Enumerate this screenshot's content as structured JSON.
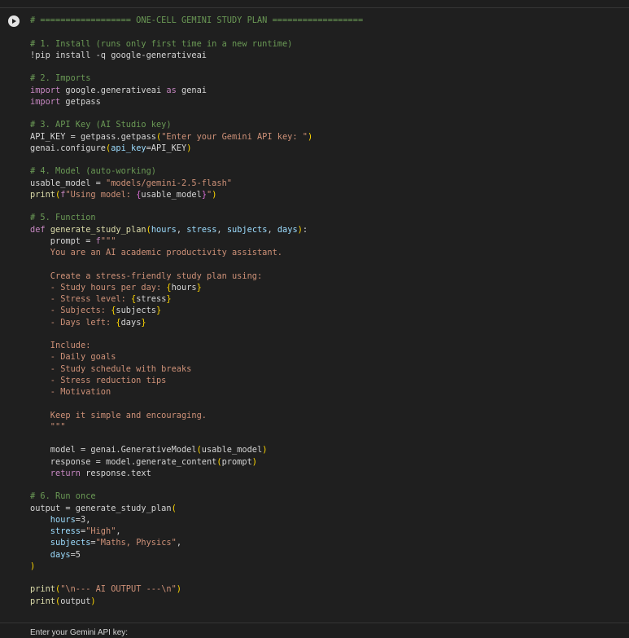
{
  "cell": {
    "run_button_label": "Run cell",
    "lines": [
      [
        {
          "c": "cm",
          "t": "# ================== ONE-CELL GEMINI STUDY PLAN =================="
        }
      ],
      [],
      [
        {
          "c": "cm",
          "t": "# 1. Install (runs only first time in a new runtime)"
        }
      ],
      [
        {
          "c": "txt",
          "t": "!pip install -q google-generativeai"
        }
      ],
      [],
      [
        {
          "c": "cm",
          "t": "# 2. Imports"
        }
      ],
      [
        {
          "c": "kw",
          "t": "import"
        },
        {
          "c": "txt",
          "t": " google.generativeai "
        },
        {
          "c": "kw",
          "t": "as"
        },
        {
          "c": "txt",
          "t": " genai"
        }
      ],
      [
        {
          "c": "kw",
          "t": "import"
        },
        {
          "c": "txt",
          "t": " getpass"
        }
      ],
      [],
      [
        {
          "c": "cm",
          "t": "# 3. API Key (AI Studio key)"
        }
      ],
      [
        {
          "c": "txt",
          "t": "API_KEY = getpass.getpass"
        },
        {
          "c": "br",
          "t": "("
        },
        {
          "c": "str",
          "t": "\"Enter your Gemini API key: \""
        },
        {
          "c": "br",
          "t": ")"
        }
      ],
      [
        {
          "c": "txt",
          "t": "genai.configure"
        },
        {
          "c": "br",
          "t": "("
        },
        {
          "c": "var",
          "t": "api_key"
        },
        {
          "c": "txt",
          "t": "=API_KEY"
        },
        {
          "c": "br",
          "t": ")"
        }
      ],
      [],
      [
        {
          "c": "cm",
          "t": "# 4. Model (auto-working)"
        }
      ],
      [
        {
          "c": "txt",
          "t": "usable_model = "
        },
        {
          "c": "str",
          "t": "\"models/gemini-2.5-flash\""
        }
      ],
      [
        {
          "c": "fn",
          "t": "print"
        },
        {
          "c": "br",
          "t": "("
        },
        {
          "c": "kw",
          "t": "f"
        },
        {
          "c": "str",
          "t": "\"Using model: "
        },
        {
          "c": "br2",
          "t": "{"
        },
        {
          "c": "txt",
          "t": "usable_model"
        },
        {
          "c": "br2",
          "t": "}"
        },
        {
          "c": "str",
          "t": "\""
        },
        {
          "c": "br",
          "t": ")"
        }
      ],
      [],
      [
        {
          "c": "cm",
          "t": "# 5. Function"
        }
      ],
      [
        {
          "c": "kw",
          "t": "def"
        },
        {
          "c": "txt",
          "t": " "
        },
        {
          "c": "fn",
          "t": "generate_study_plan"
        },
        {
          "c": "br",
          "t": "("
        },
        {
          "c": "var",
          "t": "hours"
        },
        {
          "c": "txt",
          "t": ", "
        },
        {
          "c": "var",
          "t": "stress"
        },
        {
          "c": "txt",
          "t": ", "
        },
        {
          "c": "var",
          "t": "subjects"
        },
        {
          "c": "txt",
          "t": ", "
        },
        {
          "c": "var",
          "t": "days"
        },
        {
          "c": "br",
          "t": ")"
        },
        {
          "c": "txt",
          "t": ":"
        }
      ],
      [
        {
          "c": "txt",
          "t": "    prompt = "
        },
        {
          "c": "kw",
          "t": "f"
        },
        {
          "c": "str",
          "t": "\"\"\""
        }
      ],
      [
        {
          "c": "str",
          "t": "    You are an AI academic productivity assistant."
        }
      ],
      [],
      [
        {
          "c": "str",
          "t": "    Create a stress-friendly study plan using:"
        }
      ],
      [
        {
          "c": "str",
          "t": "    - Study hours per day: "
        },
        {
          "c": "br",
          "t": "{"
        },
        {
          "c": "txt",
          "t": "hours"
        },
        {
          "c": "br",
          "t": "}"
        }
      ],
      [
        {
          "c": "str",
          "t": "    - Stress level: "
        },
        {
          "c": "br",
          "t": "{"
        },
        {
          "c": "txt",
          "t": "stress"
        },
        {
          "c": "br",
          "t": "}"
        }
      ],
      [
        {
          "c": "str",
          "t": "    - Subjects: "
        },
        {
          "c": "br",
          "t": "{"
        },
        {
          "c": "txt",
          "t": "subjects"
        },
        {
          "c": "br",
          "t": "}"
        }
      ],
      [
        {
          "c": "str",
          "t": "    - Days left: "
        },
        {
          "c": "br",
          "t": "{"
        },
        {
          "c": "txt",
          "t": "days"
        },
        {
          "c": "br",
          "t": "}"
        }
      ],
      [],
      [
        {
          "c": "str",
          "t": "    Include:"
        }
      ],
      [
        {
          "c": "str",
          "t": "    - Daily goals"
        }
      ],
      [
        {
          "c": "str",
          "t": "    - Study schedule with breaks"
        }
      ],
      [
        {
          "c": "str",
          "t": "    - Stress reduction tips"
        }
      ],
      [
        {
          "c": "str",
          "t": "    - Motivation"
        }
      ],
      [],
      [
        {
          "c": "str",
          "t": "    Keep it simple and encouraging."
        }
      ],
      [
        {
          "c": "str",
          "t": "    \"\"\""
        }
      ],
      [],
      [
        {
          "c": "txt",
          "t": "    model = genai.GenerativeModel"
        },
        {
          "c": "br",
          "t": "("
        },
        {
          "c": "txt",
          "t": "usable_model"
        },
        {
          "c": "br",
          "t": ")"
        }
      ],
      [
        {
          "c": "txt",
          "t": "    response = model.generate_content"
        },
        {
          "c": "br",
          "t": "("
        },
        {
          "c": "txt",
          "t": "prompt"
        },
        {
          "c": "br",
          "t": ")"
        }
      ],
      [
        {
          "c": "kw",
          "t": "    return"
        },
        {
          "c": "txt",
          "t": " response.text"
        }
      ],
      [],
      [
        {
          "c": "cm",
          "t": "# 6. Run once"
        }
      ],
      [
        {
          "c": "txt",
          "t": "output = generate_study_plan"
        },
        {
          "c": "br",
          "t": "("
        }
      ],
      [
        {
          "c": "var",
          "t": "    hours"
        },
        {
          "c": "txt",
          "t": "=3,"
        }
      ],
      [
        {
          "c": "var",
          "t": "    stress"
        },
        {
          "c": "txt",
          "t": "="
        },
        {
          "c": "str",
          "t": "\"High\""
        },
        {
          "c": "txt",
          "t": ","
        }
      ],
      [
        {
          "c": "var",
          "t": "    subjects"
        },
        {
          "c": "txt",
          "t": "="
        },
        {
          "c": "str",
          "t": "\"Maths, Physics\""
        },
        {
          "c": "txt",
          "t": ","
        }
      ],
      [
        {
          "c": "var",
          "t": "    days"
        },
        {
          "c": "txt",
          "t": "=5"
        }
      ],
      [
        {
          "c": "br",
          "t": ")"
        }
      ],
      [],
      [
        {
          "c": "fn",
          "t": "print"
        },
        {
          "c": "br",
          "t": "("
        },
        {
          "c": "str",
          "t": "\"\\n--- AI OUTPUT ---\\n\""
        },
        {
          "c": "br",
          "t": ")"
        }
      ],
      [
        {
          "c": "fn",
          "t": "print"
        },
        {
          "c": "br",
          "t": "("
        },
        {
          "c": "txt",
          "t": "output"
        },
        {
          "c": "br",
          "t": ")"
        }
      ]
    ]
  },
  "output": {
    "peek_text": "Enter your Gemini API key:"
  },
  "colors": {
    "background": "#1f1f1f",
    "comment": "#6a9955",
    "keyword": "#c586c0",
    "string": "#ce9178",
    "function": "#dcdcaa",
    "parameter": "#9cdcfe",
    "bracket": "#ffd700"
  }
}
